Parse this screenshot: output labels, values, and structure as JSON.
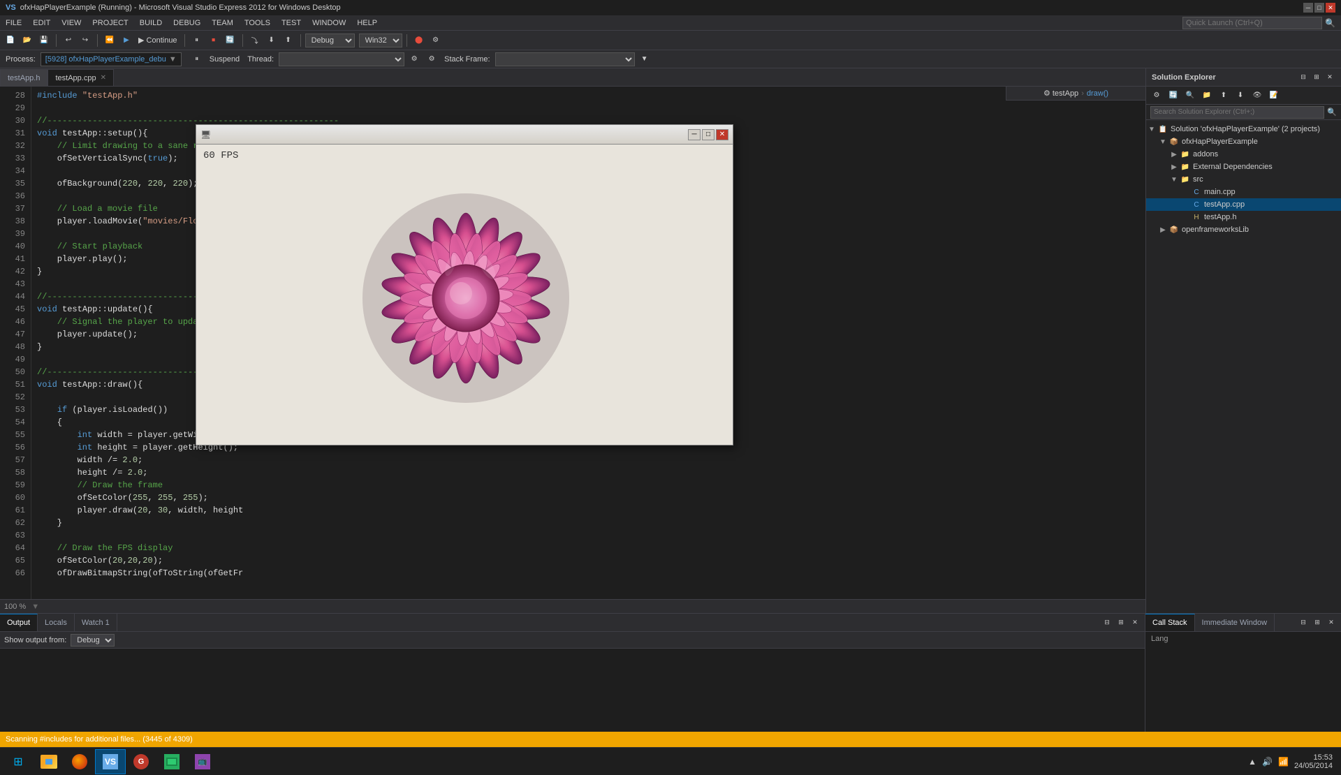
{
  "title_bar": {
    "title": "ofxHapPlayerExample (Running) - Microsoft Visual Studio Express 2012 for Windows Desktop",
    "icon": "vs-icon",
    "min_label": "─",
    "max_label": "□",
    "close_label": "✕"
  },
  "menu": {
    "items": [
      "FILE",
      "EDIT",
      "VIEW",
      "PROJECT",
      "BUILD",
      "DEBUG",
      "TEAM",
      "TOOLS",
      "TEST",
      "WINDOW",
      "HELP"
    ]
  },
  "toolbar": {
    "continue_label": "▶ Continue",
    "config_label": "Debug",
    "platform_label": "Win32",
    "quick_launch_placeholder": "Quick Launch (Ctrl+Q)"
  },
  "debug_toolbar": {
    "process_label": "Process:",
    "process_value": "[5928] ofxHapPlayerExample_debu",
    "suspend_label": "Suspend",
    "thread_label": "Thread:",
    "stack_frame_label": "Stack Frame:"
  },
  "editor": {
    "tabs": [
      {
        "id": "testApp_h",
        "label": "testApp.h",
        "active": false,
        "closable": false
      },
      {
        "id": "testApp_cpp",
        "label": "testApp.cpp",
        "active": true,
        "closable": true
      }
    ],
    "breadcrumb": "⚙ draw()",
    "current_scope": "testApp",
    "zoom_level": "100 %",
    "lines": [
      {
        "num": 28,
        "text": "#include \"testApp.h\""
      },
      {
        "num": 29,
        "text": ""
      },
      {
        "num": 30,
        "text": "//---------------------------------------------------------"
      },
      {
        "num": 31,
        "text": "void testApp::setup(){",
        "highlight": true
      },
      {
        "num": 32,
        "text": "    // Limit drawing to a sane rate"
      },
      {
        "num": 33,
        "text": "    ofSetVerticalSync(true);"
      },
      {
        "num": 34,
        "text": ""
      },
      {
        "num": 35,
        "text": "    ofBackground(220, 220, 220);"
      },
      {
        "num": 36,
        "text": ""
      },
      {
        "num": 37,
        "text": "    // Load a movie file"
      },
      {
        "num": 38,
        "text": "    player.loadMovie(\"movies/Flowers.mov\""
      },
      {
        "num": 39,
        "text": ""
      },
      {
        "num": 40,
        "text": "    // Start playback"
      },
      {
        "num": 41,
        "text": "    player.play();"
      },
      {
        "num": 42,
        "text": "}"
      },
      {
        "num": 43,
        "text": ""
      },
      {
        "num": 44,
        "text": "//---------------------------------------------------------"
      },
      {
        "num": 45,
        "text": "void testApp::update(){",
        "highlight": true
      },
      {
        "num": 46,
        "text": "    // Signal the player to update"
      },
      {
        "num": 47,
        "text": "    player.update();"
      },
      {
        "num": 48,
        "text": "}"
      },
      {
        "num": 49,
        "text": ""
      },
      {
        "num": 50,
        "text": "//---------------------------------------------------------"
      },
      {
        "num": 51,
        "text": "void testApp::draw(){",
        "highlight": true
      },
      {
        "num": 52,
        "text": ""
      },
      {
        "num": 53,
        "text": "    if (player.isLoaded())"
      },
      {
        "num": 54,
        "text": "    {"
      },
      {
        "num": 55,
        "text": "        int width = player.getWidth();"
      },
      {
        "num": 56,
        "text": "        int height = player.getHeight();"
      },
      {
        "num": 57,
        "text": "        width /= 2.0;"
      },
      {
        "num": 58,
        "text": "        height /= 2.0;"
      },
      {
        "num": 59,
        "text": "        // Draw the frame"
      },
      {
        "num": 60,
        "text": "        ofSetColor(255, 255, 255);"
      },
      {
        "num": 61,
        "text": "        player.draw(20, 30, width, height"
      },
      {
        "num": 62,
        "text": "    }"
      },
      {
        "num": 63,
        "text": ""
      },
      {
        "num": 64,
        "text": "    // Draw the FPS display"
      },
      {
        "num": 65,
        "text": "    ofSetColor(20,20,20);"
      },
      {
        "num": 66,
        "text": "    ofDrawBitmapString(ofToString(ofGetFr"
      }
    ]
  },
  "solution_explorer": {
    "title": "Solution Explorer",
    "search_placeholder": "Search Solution Explorer (Ctrl+;)",
    "tree": {
      "root": "Solution 'ofxHapPlayerExample' (2 projects)",
      "items": [
        {
          "label": "ofxHapPlayerExample",
          "level": 1,
          "expanded": true,
          "children": [
            {
              "label": "addons",
              "level": 2
            },
            {
              "label": "External Dependencies",
              "level": 2
            },
            {
              "label": "src",
              "level": 2,
              "expanded": true,
              "children": [
                {
                  "label": "main.cpp",
                  "level": 3,
                  "type": "cpp"
                },
                {
                  "label": "testApp.cpp",
                  "level": 3,
                  "type": "cpp",
                  "selected": true
                },
                {
                  "label": "testApp.h",
                  "level": 3,
                  "type": "h"
                }
              ]
            }
          ]
        },
        {
          "label": "openframeworksLib",
          "level": 1,
          "expanded": false
        }
      ]
    }
  },
  "bottom_panel": {
    "tabs": [
      {
        "id": "output",
        "label": "Output",
        "active": true
      },
      {
        "id": "locals",
        "label": "Locals"
      },
      {
        "id": "watch1",
        "label": "Watch 1"
      }
    ],
    "output_from_label": "Show output from:",
    "output_source": "Debug",
    "language_label": "Lang"
  },
  "call_stack_panel": {
    "tabs": [
      {
        "id": "call_stack",
        "label": "Call Stack",
        "active": true
      },
      {
        "id": "immediate",
        "label": "Immediate Window"
      }
    ]
  },
  "status_bar": {
    "text": "Scanning #includes for additional files... (3445 of 4309)",
    "color": "#f0a500"
  },
  "popup_window": {
    "title": "",
    "fps_display": "60 FPS",
    "min_label": "─",
    "max_label": "□",
    "close_label": "✕"
  },
  "taskbar": {
    "items": [
      {
        "id": "start",
        "icon": "⊞",
        "label": "Start"
      },
      {
        "id": "explorer",
        "icon": "📁",
        "label": "Explorer"
      },
      {
        "id": "firefox",
        "icon": "🦊",
        "label": "Firefox"
      },
      {
        "id": "vs",
        "icon": "V",
        "label": "Visual Studio",
        "active": true
      },
      {
        "id": "git",
        "icon": "⬢",
        "label": "Git"
      },
      {
        "id": "app1",
        "icon": "🎮",
        "label": "App"
      },
      {
        "id": "app2",
        "icon": "📺",
        "label": "App2"
      }
    ],
    "tray": {
      "icons": [
        "▲",
        "🔊",
        "📶"
      ],
      "time": "15:53",
      "date": "24/05/2014"
    }
  }
}
